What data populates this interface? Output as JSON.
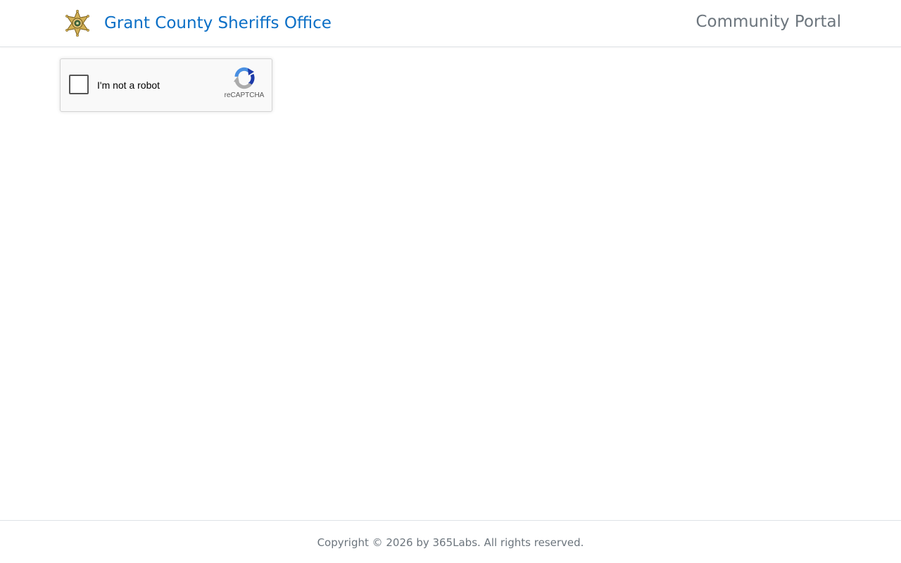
{
  "header": {
    "logo_icon": "sheriff-star-badge-icon",
    "title": "Grant County Sheriffs Office",
    "portal_link": "Community Portal"
  },
  "recaptcha": {
    "checkbox_checked": false,
    "label": "I'm not a robot",
    "brand": "reCAPTCHA",
    "logo_icon": "recaptcha-logo-icon"
  },
  "footer": {
    "copyright": "Copyright © 2026 by 365Labs. All rights reserved."
  },
  "colors": {
    "brand_blue": "#0b6fc6",
    "muted_gray": "#6c757d",
    "border": "#dee2e6",
    "badge_gold": "#c9a646"
  }
}
